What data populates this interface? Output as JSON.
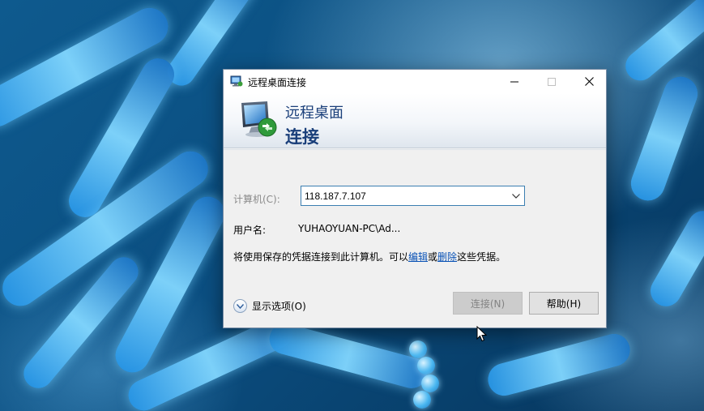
{
  "window": {
    "title": "远程桌面连接",
    "minimize_icon": "minimize-icon",
    "maximize_icon": "maximize-icon",
    "close_icon": "close-icon"
  },
  "banner": {
    "line1": "远程桌面",
    "line2": "连接",
    "icon": "remote-desktop-monitor-icon"
  },
  "form": {
    "computer_label": "计算机(C):",
    "computer_value": "118.187.7.107",
    "username_label": "用户名:",
    "username_value": "YUHAOYUAN-PC\\Ad...",
    "info_prefix": "将使用保存的凭据连接到此计算机。可以",
    "info_edit_link": "编辑",
    "info_or": "或",
    "info_delete_link": "删除",
    "info_suffix": "这些凭据。"
  },
  "footer": {
    "show_options": "显示选项(O)",
    "connect_button": "连接(N)",
    "help_button": "帮助(H)"
  },
  "colors": {
    "banner_text": "#1a3f7a",
    "link": "#0a52b5",
    "combo_border": "#3c7fb1"
  }
}
